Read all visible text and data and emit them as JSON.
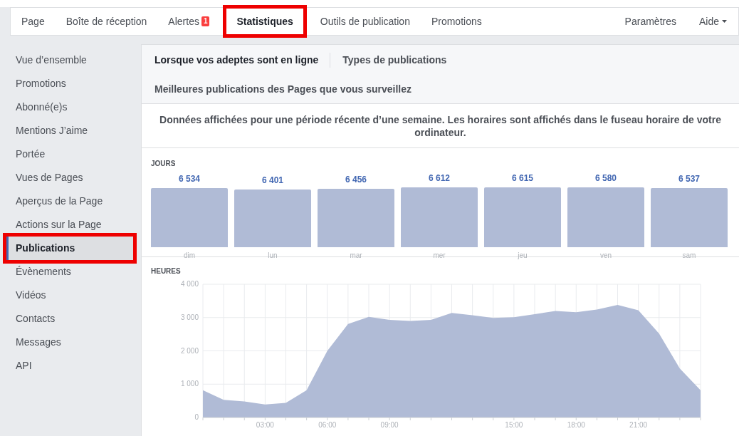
{
  "nav": {
    "tabs": [
      {
        "label": "Page",
        "selected": false,
        "highlighted": false
      },
      {
        "label": "Boîte de réception",
        "selected": false,
        "highlighted": false
      },
      {
        "label": "Alertes",
        "badge": "1",
        "selected": false,
        "highlighted": false
      },
      {
        "label": "Statistiques",
        "selected": true,
        "highlighted": true
      },
      {
        "label": "Outils de publication",
        "selected": false,
        "highlighted": false
      },
      {
        "label": "Promotions",
        "selected": false,
        "highlighted": false
      }
    ],
    "right": [
      {
        "label": "Paramètres"
      },
      {
        "label": "Aide",
        "dropdown": true
      }
    ]
  },
  "sidebar": {
    "items": [
      {
        "label": "Vue d’ensemble",
        "selected": false,
        "highlighted": false
      },
      {
        "label": "Promotions",
        "selected": false,
        "highlighted": false
      },
      {
        "label": "Abonné(e)s",
        "selected": false,
        "highlighted": false
      },
      {
        "label": "Mentions J’aime",
        "selected": false,
        "highlighted": false
      },
      {
        "label": "Portée",
        "selected": false,
        "highlighted": false
      },
      {
        "label": "Vues de Pages",
        "selected": false,
        "highlighted": false
      },
      {
        "label": "Aperçus de la Page",
        "selected": false,
        "highlighted": false
      },
      {
        "label": "Actions sur la Page",
        "selected": false,
        "highlighted": false
      },
      {
        "label": "Publications",
        "selected": true,
        "highlighted": true
      },
      {
        "label": "Évènements",
        "selected": false,
        "highlighted": false
      },
      {
        "label": "Vidéos",
        "selected": false,
        "highlighted": false
      },
      {
        "label": "Contacts",
        "selected": false,
        "highlighted": false
      },
      {
        "label": "Messages",
        "selected": false,
        "highlighted": false
      },
      {
        "label": "API",
        "selected": false,
        "highlighted": false
      }
    ]
  },
  "subtabs": [
    {
      "label": "Lorsque vos adeptes sont en ligne",
      "selected": true
    },
    {
      "label": "Types de publications",
      "selected": false
    },
    {
      "label": "Meilleures publications des Pages que vous surveillez",
      "selected": false
    }
  ],
  "notice": "Données affichées pour une période récente d’une semaine. Les horaires sont affichés dans le fuseau horaire de votre ordinateur.",
  "days": {
    "title": "JOURS",
    "chart_data": {
      "type": "bar",
      "categories": [
        "dim",
        "lun",
        "mar",
        "mer",
        "jeu",
        "ven",
        "sam"
      ],
      "series": [
        {
          "color": "#b0bbd6",
          "values": [
            6534,
            6401,
            6456,
            6612,
            6615,
            6580,
            6537
          ]
        }
      ],
      "data_labels": true,
      "value_labels": [
        "6 534",
        "6 401",
        "6 456",
        "6 612",
        "6 615",
        "6 580",
        "6 537"
      ]
    }
  },
  "hours": {
    "title": "HEURES",
    "chart_data": {
      "type": "area",
      "x": [
        0,
        1,
        2,
        3,
        4,
        5,
        6,
        7,
        8,
        9,
        10,
        11,
        12,
        13,
        14,
        15,
        16,
        17,
        18,
        19,
        20,
        21,
        22,
        23,
        24
      ],
      "grid": true,
      "series": [
        {
          "color": "#b0bbd6",
          "values": [
            820,
            530,
            480,
            390,
            440,
            820,
            2000,
            2810,
            3020,
            2930,
            2900,
            2930,
            3140,
            3070,
            2990,
            3010,
            3100,
            3200,
            3160,
            3240,
            3380,
            3220,
            2520,
            1470,
            820
          ]
        }
      ],
      "xlim": [
        0,
        24
      ],
      "ylim": [
        0,
        4000
      ],
      "xticks": [
        {
          "value": 3,
          "label": "03:00"
        },
        {
          "value": 6,
          "label": "06:00"
        },
        {
          "value": 9,
          "label": "09:00"
        },
        {
          "value": 15,
          "label": "15:00"
        },
        {
          "value": 18,
          "label": "18:00"
        },
        {
          "value": 21,
          "label": "21:00"
        }
      ],
      "yticks": [
        {
          "value": 0,
          "label": "0"
        },
        {
          "value": 1000,
          "label": "1 000"
        },
        {
          "value": 2000,
          "label": "2 000"
        },
        {
          "value": 3000,
          "label": "3 000"
        },
        {
          "value": 4000,
          "label": "4 000"
        }
      ]
    }
  }
}
